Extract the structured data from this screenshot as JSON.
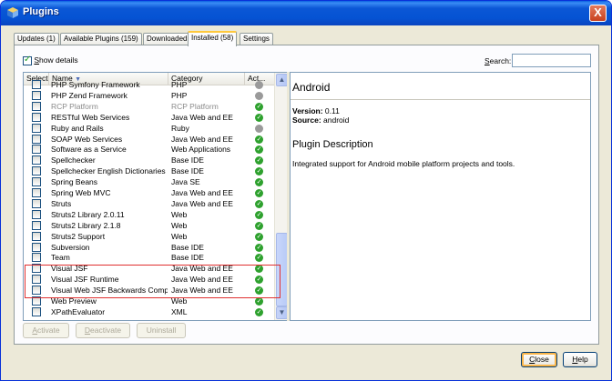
{
  "window": {
    "title": "Plugins",
    "close_glyph": "X"
  },
  "tabs": [
    {
      "label": "Updates (1)",
      "active": false
    },
    {
      "label": "Available Plugins (159)",
      "active": false
    },
    {
      "label": "Downloaded",
      "active": false
    },
    {
      "label": "Installed (58)",
      "active": true
    },
    {
      "label": "Settings",
      "active": false
    }
  ],
  "show_details": {
    "label_prefix": "S",
    "label_rest": "how details",
    "checked": true
  },
  "search": {
    "label": "Search:",
    "value": ""
  },
  "table": {
    "columns": {
      "select": "Select",
      "name": "Name",
      "sort_glyph": "▼",
      "category": "Category",
      "active": "Act..."
    },
    "rows": [
      {
        "name": "PHP Symfony Framework",
        "category": "PHP",
        "status": "gray",
        "disabled": false
      },
      {
        "name": "PHP Zend Framework",
        "category": "PHP",
        "status": "gray",
        "disabled": false
      },
      {
        "name": "RCP Platform",
        "category": "RCP Platform",
        "status": "green",
        "disabled": true
      },
      {
        "name": "RESTful Web Services",
        "category": "Java Web and EE",
        "status": "green",
        "disabled": false
      },
      {
        "name": "Ruby and Rails",
        "category": "Ruby",
        "status": "gray",
        "disabled": false
      },
      {
        "name": "SOAP Web Services",
        "category": "Java Web and EE",
        "status": "green",
        "disabled": false
      },
      {
        "name": "Software as a Service",
        "category": "Web Applications",
        "status": "green",
        "disabled": false
      },
      {
        "name": "Spellchecker",
        "category": "Base IDE",
        "status": "green",
        "disabled": false
      },
      {
        "name": "Spellchecker English Dictionaries",
        "category": "Base IDE",
        "status": "green",
        "disabled": false
      },
      {
        "name": "Spring Beans",
        "category": "Java SE",
        "status": "green",
        "disabled": false
      },
      {
        "name": "Spring Web MVC",
        "category": "Java Web and EE",
        "status": "green",
        "disabled": false
      },
      {
        "name": "Struts",
        "category": "Java Web and EE",
        "status": "green",
        "disabled": false
      },
      {
        "name": "Struts2 Library 2.0.11",
        "category": "Web",
        "status": "green",
        "disabled": false
      },
      {
        "name": "Struts2 Library 2.1.8",
        "category": "Web",
        "status": "green",
        "disabled": false
      },
      {
        "name": "Struts2 Support",
        "category": "Web",
        "status": "green",
        "disabled": false
      },
      {
        "name": "Subversion",
        "category": "Base IDE",
        "status": "green",
        "disabled": false
      },
      {
        "name": "Team",
        "category": "Base IDE",
        "status": "green",
        "disabled": false
      },
      {
        "name": "Visual JSF",
        "category": "Java Web and EE",
        "status": "green",
        "disabled": false
      },
      {
        "name": "Visual JSF Runtime",
        "category": "Java Web and EE",
        "status": "green",
        "disabled": false
      },
      {
        "name": "Visual Web JSF Backwards Compa...",
        "category": "Java Web and EE",
        "status": "green",
        "disabled": false
      },
      {
        "name": "Web Preview",
        "category": "Web",
        "status": "green",
        "disabled": false
      },
      {
        "name": "XPathEvaluator",
        "category": "XML",
        "status": "green",
        "disabled": false
      }
    ],
    "check_glyph": "✓"
  },
  "details": {
    "title": "Android",
    "version_label": "Version:",
    "version": "0.11",
    "source_label": "Source:",
    "source": "android",
    "description_title": "Plugin Description",
    "description": "Integrated support for Android mobile platform projects and tools."
  },
  "buttons": {
    "activate": {
      "key": "A",
      "rest": "ctivate"
    },
    "deactivate": {
      "key": "D",
      "rest": "eactivate"
    },
    "uninstall": {
      "key": "",
      "rest": "Uninstall"
    },
    "close": {
      "key": "C",
      "rest": "lose"
    },
    "help": {
      "key": "H",
      "rest": "elp"
    }
  },
  "colors": {
    "highlight_box": "#e03030",
    "active_green": "#2ea12e",
    "titlebar": "#0553d3"
  }
}
